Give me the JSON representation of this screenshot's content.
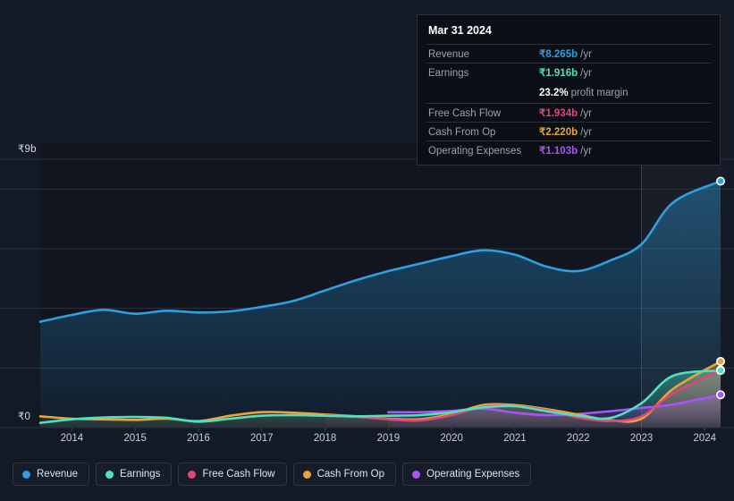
{
  "tooltip": {
    "date": "Mar 31 2024",
    "rows": [
      {
        "key": "Revenue",
        "value": "₹8.265b",
        "unit": "/yr",
        "color": "#2e9fe0"
      },
      {
        "key": "Earnings",
        "value": "₹1.916b",
        "unit": "/yr",
        "color": "#4fe0c0"
      },
      {
        "key": "Free Cash Flow",
        "value": "₹1.934b",
        "unit": "/yr",
        "color": "#e0457b"
      },
      {
        "key": "Cash From Op",
        "value": "₹2.220b",
        "unit": "/yr",
        "color": "#e8a33d"
      },
      {
        "key": "Operating Expenses",
        "value": "₹1.103b",
        "unit": "/yr",
        "color": "#a855f7"
      }
    ],
    "profit_margin_value": "23.2%",
    "profit_margin_label": "profit margin"
  },
  "legend": {
    "items": [
      {
        "label": "Revenue",
        "color": "#2e9fe0"
      },
      {
        "label": "Earnings",
        "color": "#4fe0c0"
      },
      {
        "label": "Free Cash Flow",
        "color": "#e0457b"
      },
      {
        "label": "Cash From Op",
        "color": "#e8a33d"
      },
      {
        "label": "Operating Expenses",
        "color": "#a855f7"
      }
    ]
  },
  "chart_data": {
    "type": "area",
    "title": "",
    "xlabel": "",
    "ylabel": "",
    "ylim": [
      0,
      9
    ],
    "y_unit": "₹b",
    "y_ticks": [
      {
        "value": 9,
        "label": "₹9b"
      },
      {
        "value": 0,
        "label": "₹0"
      }
    ],
    "gridlines": [
      9,
      8,
      6,
      4,
      2,
      0
    ],
    "grid": true,
    "legend_position": "bottom",
    "x_tick_labels": [
      "2014",
      "2015",
      "2016",
      "2017",
      "2018",
      "2019",
      "2020",
      "2021",
      "2022",
      "2023",
      "2024"
    ],
    "x_range": [
      "2013-06",
      "2024-03"
    ],
    "highlighted_period_start": "2023",
    "series": [
      {
        "name": "Revenue",
        "color": "#2e9fe0",
        "x": [
          2013.5,
          2014,
          2014.5,
          2015,
          2015.5,
          2016,
          2016.5,
          2017,
          2017.5,
          2018,
          2018.5,
          2019,
          2019.5,
          2020,
          2020.5,
          2021,
          2021.5,
          2022,
          2022.5,
          2023,
          2023.5,
          2024.25
        ],
        "values": [
          3.55,
          3.78,
          3.95,
          3.82,
          3.92,
          3.86,
          3.9,
          4.05,
          4.25,
          4.6,
          4.95,
          5.25,
          5.5,
          5.75,
          5.95,
          5.8,
          5.4,
          5.25,
          5.6,
          6.15,
          7.55,
          8.265
        ]
      },
      {
        "name": "Earnings",
        "color": "#4fe0c0",
        "x": [
          2013.5,
          2014,
          2014.5,
          2015,
          2015.5,
          2016,
          2016.5,
          2017,
          2017.5,
          2018,
          2018.5,
          2019,
          2019.5,
          2020,
          2020.5,
          2021,
          2021.5,
          2022,
          2022.5,
          2023,
          2023.5,
          2024.25
        ],
        "values": [
          0.16,
          0.28,
          0.34,
          0.36,
          0.33,
          0.2,
          0.3,
          0.4,
          0.42,
          0.4,
          0.38,
          0.4,
          0.42,
          0.52,
          0.68,
          0.72,
          0.55,
          0.4,
          0.32,
          0.82,
          1.74,
          1.916
        ]
      },
      {
        "name": "Free Cash Flow",
        "color": "#e0457b",
        "x": [
          2018,
          2018.5,
          2019,
          2019.5,
          2020,
          2020.5,
          2021,
          2021.5,
          2022,
          2022.5,
          2023,
          2023.5,
          2024.25
        ],
        "values": [
          0.42,
          0.36,
          0.28,
          0.24,
          0.42,
          0.7,
          0.72,
          0.58,
          0.34,
          0.22,
          0.38,
          1.15,
          1.934
        ]
      },
      {
        "name": "Cash From Op",
        "color": "#e8a33d",
        "x": [
          2013.5,
          2014,
          2014.5,
          2015,
          2015.5,
          2016,
          2016.5,
          2017,
          2017.5,
          2018,
          2018.5,
          2019,
          2019.5,
          2020,
          2020.5,
          2021,
          2021.5,
          2022,
          2022.5,
          2023,
          2023.5,
          2024.25
        ],
        "values": [
          0.38,
          0.3,
          0.28,
          0.26,
          0.3,
          0.22,
          0.4,
          0.52,
          0.5,
          0.44,
          0.38,
          0.3,
          0.28,
          0.46,
          0.76,
          0.76,
          0.62,
          0.44,
          0.25,
          0.3,
          1.3,
          2.22
        ]
      },
      {
        "name": "Operating Expenses",
        "color": "#a855f7",
        "x": [
          2019,
          2019.5,
          2020,
          2020.5,
          2021,
          2021.5,
          2022,
          2022.5,
          2023,
          2023.5,
          2024.25
        ],
        "values": [
          0.52,
          0.52,
          0.56,
          0.64,
          0.5,
          0.42,
          0.46,
          0.55,
          0.66,
          0.78,
          1.103
        ]
      }
    ],
    "endpoints": [
      {
        "name": "Revenue",
        "value": 8.265,
        "color": "#2e9fe0"
      },
      {
        "name": "Cash From Op",
        "value": 2.22,
        "color": "#e8a33d"
      },
      {
        "name": "Free Cash Flow",
        "value": 1.934,
        "color": "#e0457b"
      },
      {
        "name": "Earnings",
        "value": 1.916,
        "color": "#4fe0c0"
      },
      {
        "name": "Operating Expenses",
        "value": 1.103,
        "color": "#a855f7"
      }
    ]
  }
}
